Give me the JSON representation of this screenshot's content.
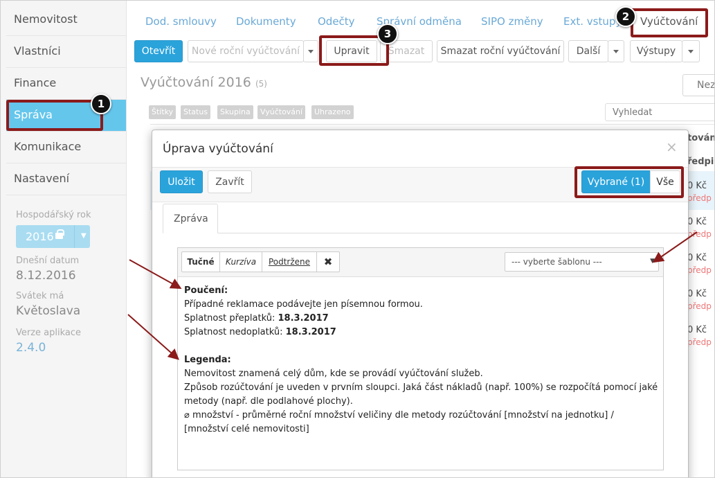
{
  "sidebar": {
    "items": [
      {
        "label": "Nemovitost"
      },
      {
        "label": "Vlastníci"
      },
      {
        "label": "Finance"
      },
      {
        "label": "Správa"
      },
      {
        "label": "Komunikace"
      },
      {
        "label": "Nastavení"
      }
    ],
    "fiscal_year_label": "Hospodářský rok",
    "fiscal_year_value": "2016",
    "today_label": "Dnešní datum",
    "today_value": "8.12.2016",
    "nameday_label": "Svátek má",
    "nameday_value": "Květoslava",
    "version_label": "Verze aplikace",
    "version_value": "2.4.0"
  },
  "tabs": [
    {
      "label": "Dod. smlouvy"
    },
    {
      "label": "Dokumenty"
    },
    {
      "label": "Odečty"
    },
    {
      "label": "Správní odměna"
    },
    {
      "label": "SIPO změny"
    },
    {
      "label": "Ext. vstupy"
    },
    {
      "label": "Vyúčtování"
    }
  ],
  "toolbar": {
    "open": "Otevřít",
    "new_annual": "Nové roční vyúčtování",
    "edit": "Upravit",
    "delete": "Smazat",
    "delete_annual": "Smazat roční vyúčtování",
    "more": "Další",
    "outputs": "Výstupy"
  },
  "list": {
    "title": "Vyúčtování 2016",
    "count": "(5)",
    "filters": [
      "Štítky",
      "Status",
      "Skupina",
      "Vyúčtování",
      "Uhrazeno"
    ],
    "search_placeholder": "Vyhledat",
    "right_toggle": "Nez",
    "col_header_1": "tován",
    "col_header_2": "ředpis",
    "rows": [
      {
        "amount": "0 Kč",
        "note": "předp"
      },
      {
        "amount": "0 Kč",
        "note": "předp"
      },
      {
        "amount": "0 Kč",
        "note": "předp"
      },
      {
        "amount": "0 Kč",
        "note": "předp"
      },
      {
        "amount": "0 Kč",
        "note": "předp"
      }
    ]
  },
  "modal": {
    "title": "Úprava vyúčtování",
    "save": "Uložit",
    "close": "Zavřít",
    "selected": "Vybrané (1)",
    "all": "Vše",
    "tab": "Zpráva",
    "editor": {
      "bold": "Tučné",
      "italic": "Kurzíva",
      "underline": "Podtržene",
      "template_placeholder": "--- vyberte šablonu ---",
      "lines": {
        "h1": "Poučení:",
        "l1": "Případné reklamace podávejte jen písemnou formou.",
        "l2_label": "Splatnost přeplatků: ",
        "l2_value": "18.3.2017",
        "l3_label": "Splatnost nedoplatků: ",
        "l3_value": "18.3.2017",
        "h2": "Legenda:",
        "l4": "Nemovitost znamená celý dům, kde se provádí vyúčtování služeb.",
        "l5": "Způsob rozúčtování je uveden v prvním sloupci. Jaká část nákladů (např. 100%) se rozpočítá pomocí jaké",
        "l6": "metody (např. dle podlahové plochy).",
        "l7": "⌀ množství - průměrné roční množství veličiny dle metody rozúčtování [množství na jednotku] /",
        "l8": "[množství celé nemovitosti]"
      }
    }
  },
  "annotations": {
    "n1": "1",
    "n2": "2",
    "n3": "3",
    "color": "#8b1a1a"
  }
}
